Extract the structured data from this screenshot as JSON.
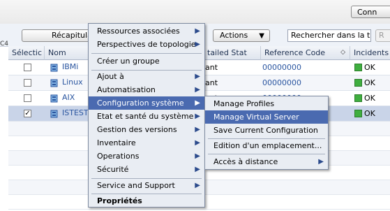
{
  "topbar": {
    "connect_label": "Conn"
  },
  "toolbar": {
    "side_marker": "C4",
    "summary_label": "Récapitula",
    "actions_label": "Actions",
    "actions_arrow": "▼",
    "search_value": "Rechercher dans la ta",
    "search_go_label": "R"
  },
  "table": {
    "columns": [
      {
        "label": "Sélectic"
      },
      {
        "label": "Nom"
      },
      {
        "label": "tailed Stat"
      },
      {
        "label": "Reference Code"
      },
      {
        "label": "Incidents"
      }
    ],
    "rows": [
      {
        "checked": false,
        "name": "IBMi",
        "status": "ant",
        "ref": "00000000",
        "incident": "OK"
      },
      {
        "checked": false,
        "name": "Linux",
        "status": "ant",
        "ref": "00000000",
        "incident": "OK"
      },
      {
        "checked": false,
        "name": "AIX",
        "status": "ant",
        "ref": "00000000",
        "incident": "OK"
      },
      {
        "checked": true,
        "check_glyph": "✓",
        "name": "ISTEST",
        "status": "",
        "ref": "00000000",
        "incident": "OK"
      }
    ]
  },
  "context_menu": {
    "items": [
      {
        "label": "Ressources associées",
        "submenu": true
      },
      {
        "label": "Perspectives de topologie",
        "submenu": true
      },
      {
        "label": "Créer un groupe",
        "submenu": false
      },
      {
        "label": "Ajout à",
        "submenu": true
      },
      {
        "label": "Automatisation",
        "submenu": true
      },
      {
        "label": "Configuration système",
        "submenu": true,
        "highlighted": true
      },
      {
        "label": "Etat et santé du système",
        "submenu": true
      },
      {
        "label": "Gestion des versions",
        "submenu": true
      },
      {
        "label": "Inventaire",
        "submenu": true
      },
      {
        "label": "Operations",
        "submenu": true
      },
      {
        "label": "Sécurité",
        "submenu": true
      },
      {
        "label": "Service and Support",
        "submenu": true
      },
      {
        "label": "Propriétés",
        "submenu": false,
        "bold": true
      }
    ],
    "submenu_arrow": "▶"
  },
  "sub_menu": {
    "items": [
      {
        "label": "Manage Profiles"
      },
      {
        "label": "Manage Virtual Server",
        "highlighted": true
      },
      {
        "label": "Save Current Configuration"
      },
      {
        "label": "Edition d'un emplacement..."
      },
      {
        "label": "Accès à distance",
        "submenu": true
      }
    ]
  },
  "colors": {
    "highlight": "#4a6ab0",
    "ok_green": "#3fae3f",
    "link_blue": "#2b56a0"
  }
}
